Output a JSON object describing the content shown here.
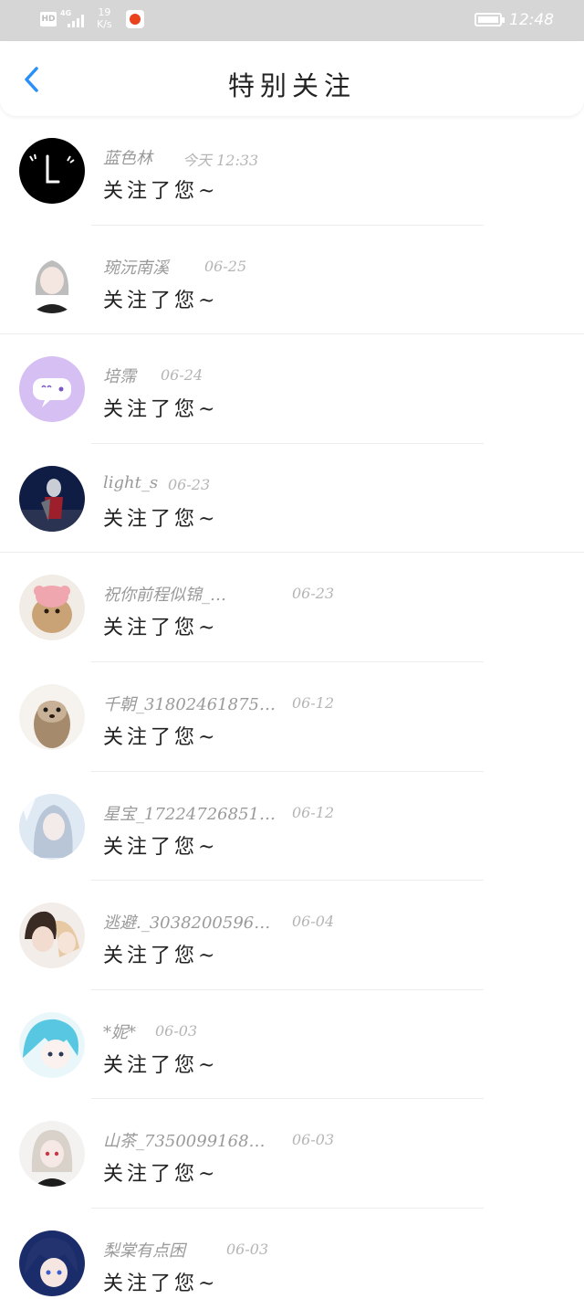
{
  "status_bar": {
    "hd": "HD",
    "network": "4G",
    "speed_value": "19",
    "speed_unit": "K/s",
    "time": "12:48",
    "colors": {
      "background": "#d6d6d6",
      "app_icon": "#e8431d"
    }
  },
  "header": {
    "title": "特别关注",
    "back_icon": "chevron-left-icon",
    "accent": "#2a8ff7"
  },
  "items": [
    {
      "name": "蓝色林",
      "date": "今天 12:33",
      "message": "关注了您~"
    },
    {
      "name": "琬沅南溪",
      "date": "06-25",
      "message": "关注了您~"
    },
    {
      "name": "培霈",
      "date": "06-24",
      "message": "关注了您~"
    },
    {
      "name": "light_s",
      "date": "06-23",
      "message": "关注了您~"
    },
    {
      "name": "祝你前程似锦_…",
      "date": "06-23",
      "message": "关注了您~"
    },
    {
      "name": "千朝_31802461875…",
      "date": "06-12",
      "message": "关注了您~"
    },
    {
      "name": "星宝_17224726851…",
      "date": "06-12",
      "message": "关注了您~"
    },
    {
      "name": "逃避._3038200596…",
      "date": "06-04",
      "message": "关注了您~"
    },
    {
      "name": "*妮*",
      "date": "06-03",
      "message": "关注了您~"
    },
    {
      "name": "山茶_7350099168…",
      "date": "06-03",
      "message": "关注了您~"
    },
    {
      "name": "梨棠有点困",
      "date": "06-03",
      "message": "关注了您~"
    }
  ]
}
